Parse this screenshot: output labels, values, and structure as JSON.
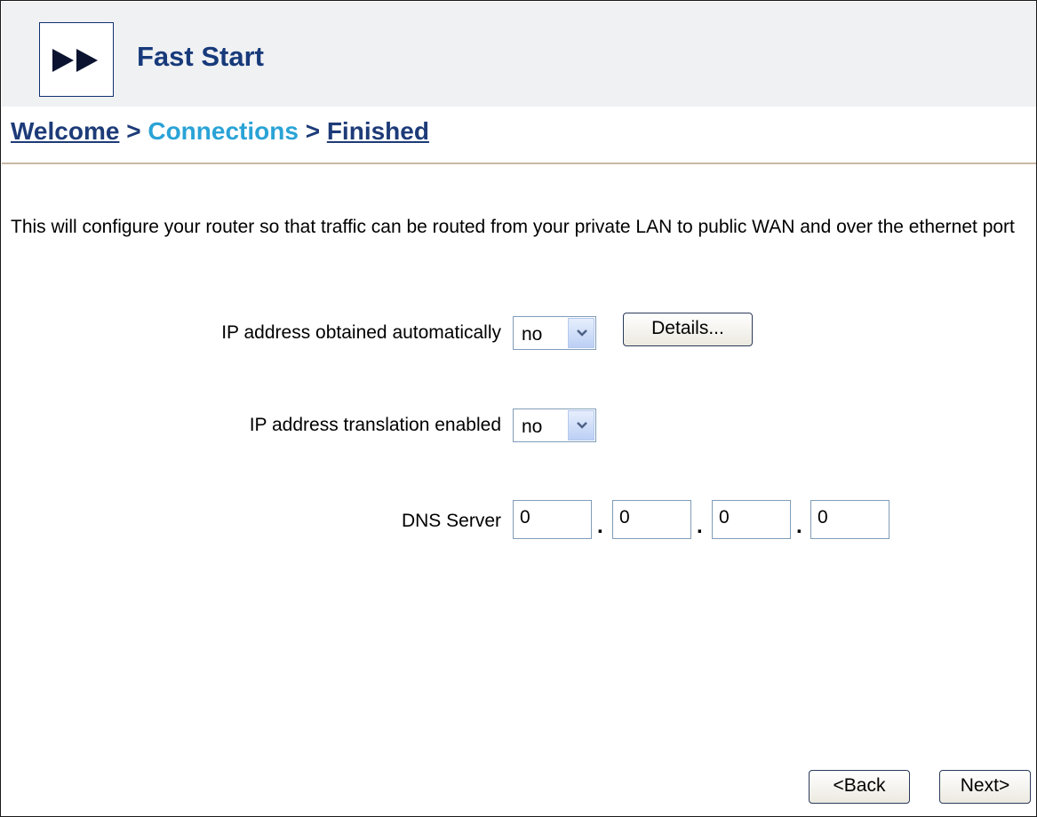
{
  "header": {
    "title": "Fast Start",
    "logo_icon": "fast-forward-icon"
  },
  "breadcrumb": {
    "steps": [
      "Welcome",
      "Connections",
      "Finished"
    ],
    "separator": ">",
    "current": "Connections"
  },
  "intro_text": "This will configure your router so that traffic can be routed from your private LAN to public WAN and over the ethernet port",
  "form": {
    "ip_auto": {
      "label": "IP address obtained automatically",
      "value": "no"
    },
    "details_button": "Details...",
    "ip_translation": {
      "label": "IP address translation enabled",
      "value": "no"
    },
    "dns": {
      "label": "DNS Server",
      "octets": [
        "0",
        "0",
        "0",
        "0"
      ],
      "separator": "."
    }
  },
  "footer": {
    "back_label": "<Back",
    "next_label": "Next>"
  },
  "colors": {
    "title": "#173a7a",
    "current_step": "#2aa3d6",
    "link": "#1d3b78",
    "header_bg": "#f0f1f3"
  }
}
